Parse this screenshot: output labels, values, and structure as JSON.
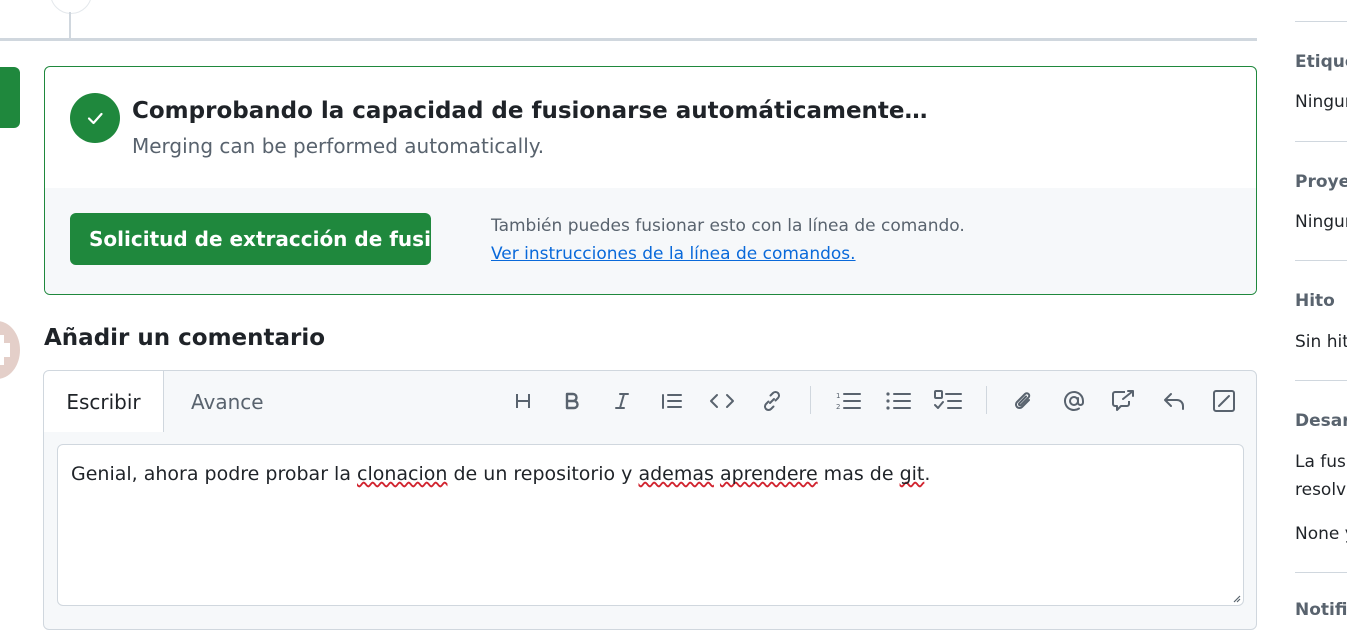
{
  "merge": {
    "title": "Comprobando la capacidad de fusionarse automáticamente…",
    "subtitle": "Merging can be performed automatically.",
    "button_label": "Solicitud de extracción de fusión",
    "alt_text": "También puedes fusionar esto con la línea de comando.",
    "cli_link": "Ver instrucciones de la línea de comandos."
  },
  "comment": {
    "heading": "Añadir un comentario",
    "tabs": {
      "write": "Escribir",
      "preview": "Avance"
    },
    "text_parts": [
      "Genial, ahora podre probar la ",
      "clonacion",
      " de un repositorio y ",
      "ademas",
      " ",
      "aprendere",
      " mas de ",
      "git",
      "."
    ],
    "toolbar_icons": [
      "heading-icon",
      "bold-icon",
      "italic-icon",
      "quote-icon",
      "code-icon",
      "link-icon",
      "ordered-list-icon",
      "unordered-list-icon",
      "task-list-icon",
      "attach-icon",
      "mention-icon",
      "cross-reference-icon",
      "reply-icon",
      "fullscreen-icon"
    ]
  },
  "sidebar": {
    "labels": {
      "label": "Etiquetas",
      "projects": "Proyectos",
      "milestone": "Hito",
      "development": "Desarrollo",
      "notifications": "Notificaciones"
    },
    "values": {
      "labels_value": "Ninguno",
      "projects_value": "Ninguno",
      "milestone_value": "Sin hito",
      "development_line1": "La fusión",
      "development_line2": "resolver",
      "development_line3": "None y"
    }
  },
  "colors": {
    "success": "#1f883d",
    "link": "#0969da",
    "muted": "#59636e",
    "border": "#d0d7de"
  }
}
